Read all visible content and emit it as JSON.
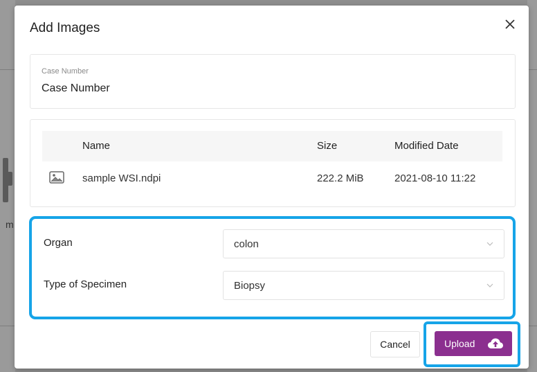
{
  "background": {
    "fragment_text": "m"
  },
  "modal": {
    "title": "Add Images",
    "close_icon": "close-icon"
  },
  "case": {
    "label": "Case Number",
    "value": "Case Number"
  },
  "files": {
    "columns": [
      "Name",
      "Size",
      "Modified Date"
    ],
    "rows": [
      {
        "icon": "image-file-icon",
        "name": "sample WSI.ndpi",
        "size": "222.2 MiB",
        "modified": "2021-08-10 11:22"
      }
    ]
  },
  "fields": {
    "organ": {
      "label": "Organ",
      "value": "colon"
    },
    "specimen": {
      "label": "Type of Specimen",
      "value": "Biopsy"
    }
  },
  "buttons": {
    "cancel": "Cancel",
    "upload": "Upload",
    "upload_icon": "cloud-upload-icon"
  },
  "colors": {
    "accent": "#8b2f8f",
    "highlight": "#16a4e8"
  }
}
